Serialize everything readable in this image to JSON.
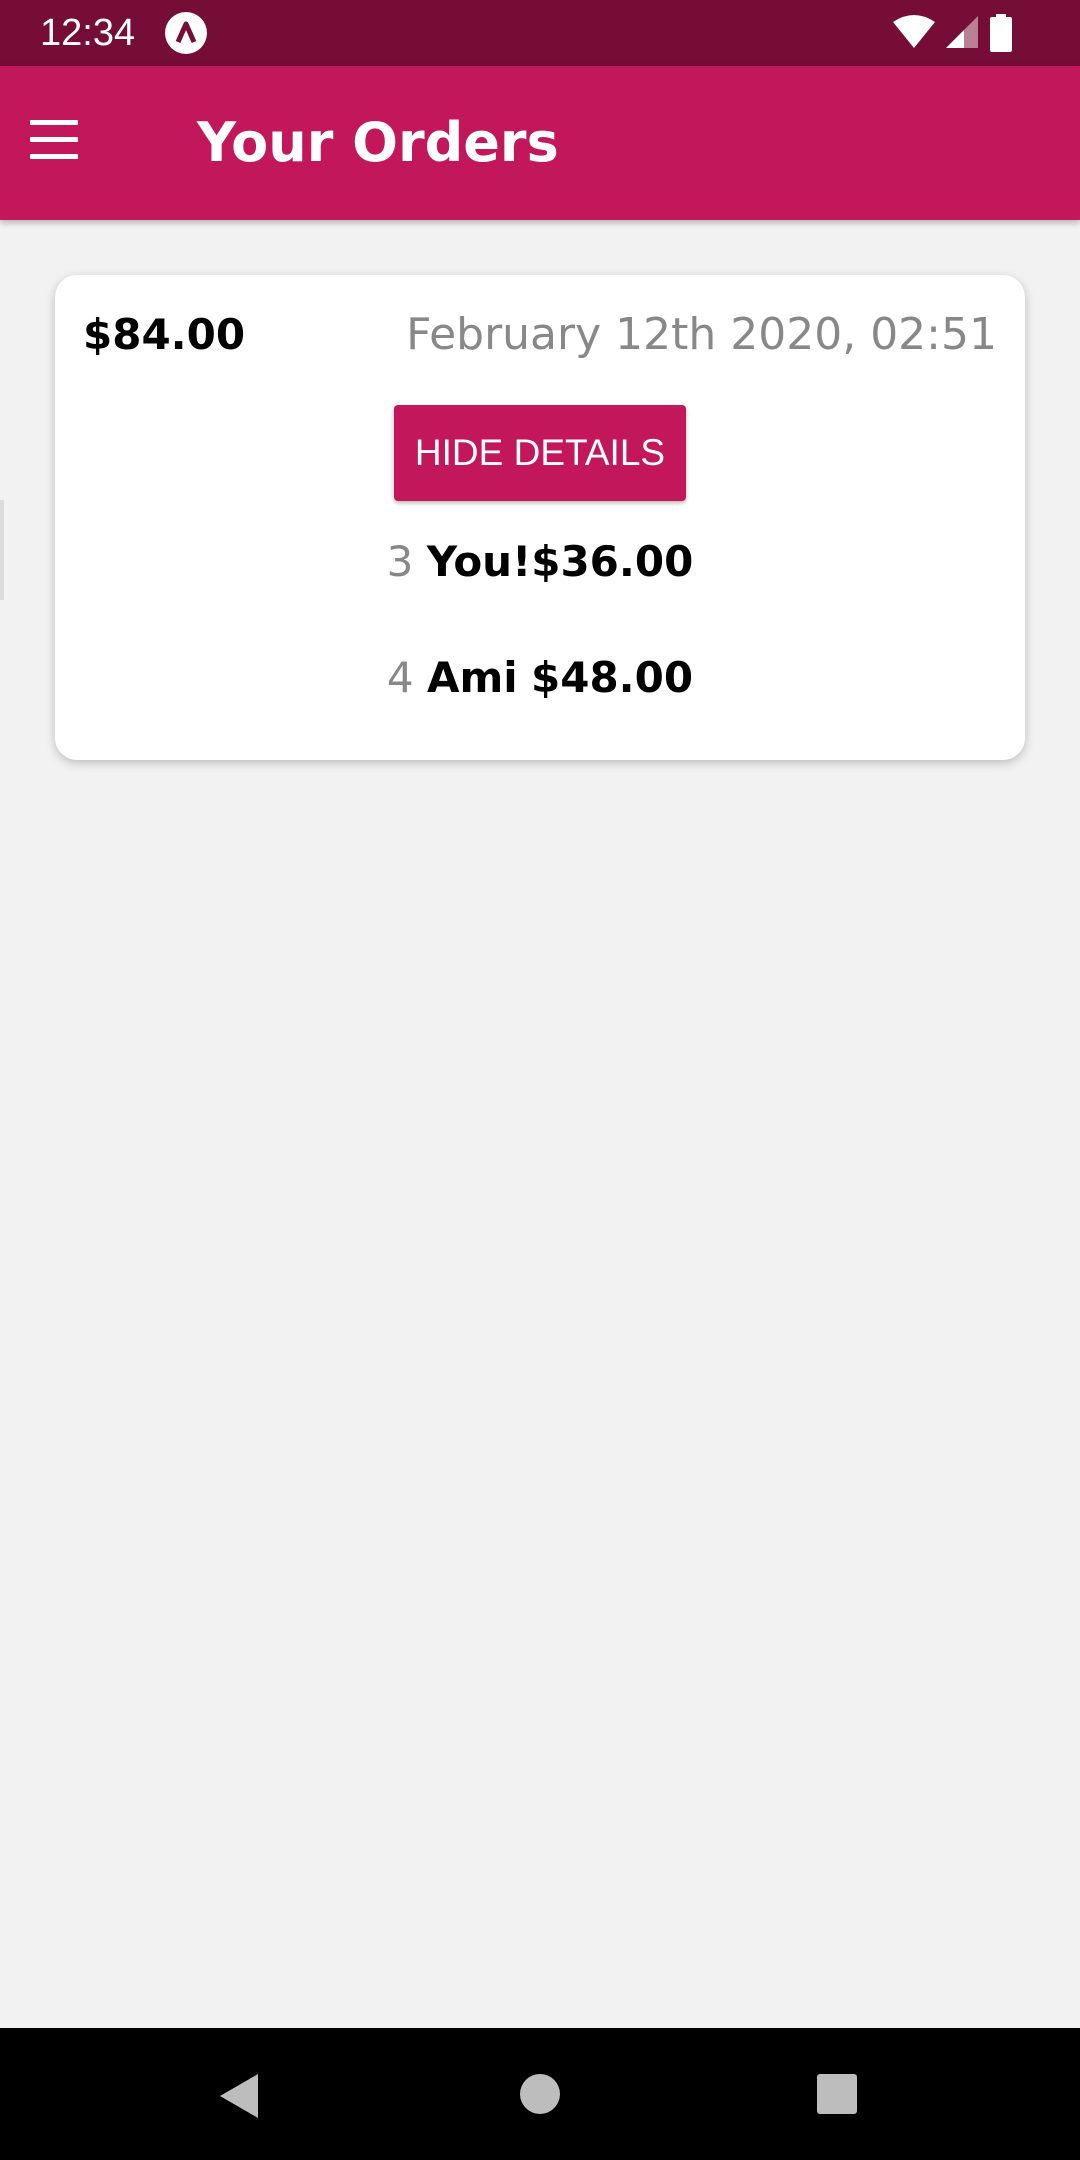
{
  "status_bar": {
    "time": "12:34",
    "icons": [
      "app-notification-icon",
      "wifi-icon",
      "signal-icon",
      "battery-icon"
    ]
  },
  "app_bar": {
    "title": "Your Orders",
    "menu_icon": "hamburger-menu-icon"
  },
  "order": {
    "total": "$84.00",
    "date": "February 12th 2020, 02:51",
    "toggle_label": "HIDE DETAILS",
    "items": [
      {
        "quantity": "3",
        "name": "You!",
        "price": "$36.00"
      },
      {
        "quantity": "4",
        "name": "Ami",
        "price": "$48.00"
      }
    ]
  },
  "nav_bar": {
    "icons": [
      "back-icon",
      "home-icon",
      "recent-apps-icon"
    ]
  },
  "colors": {
    "status_bar": "#750d36",
    "accent": "#c2185b",
    "background": "#f2f2f2",
    "muted_text": "#888888"
  }
}
